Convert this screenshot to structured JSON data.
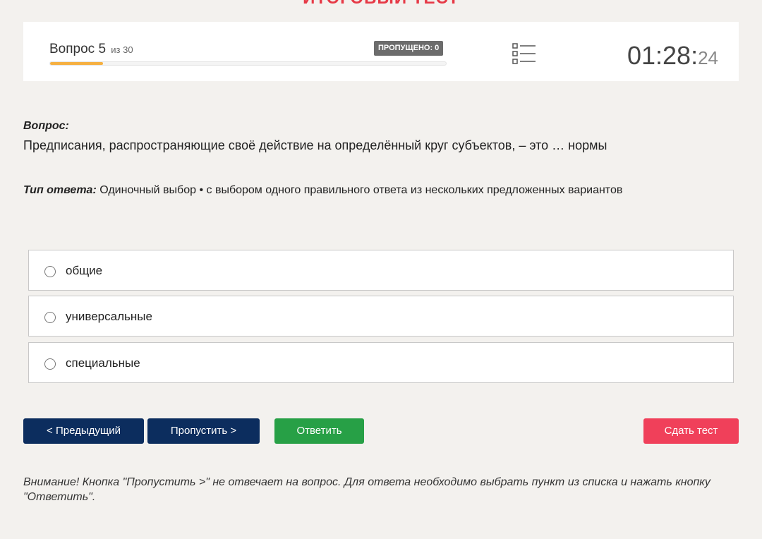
{
  "page": {
    "title": "ИТОГОВЫЙ ТЕСТ"
  },
  "header": {
    "question_prefix": "Вопрос 5",
    "question_of": "из 30",
    "skipped_badge": "ПРОПУЩЕНО: 0",
    "progress_fraction": 0.133,
    "list_icon": "list-icon",
    "timer_main": "01:28:",
    "timer_seconds": "24"
  },
  "question": {
    "label": "Вопрос:",
    "text": "Предписания, распространяющие своё действие на определённый круг субъектов, – это … нормы",
    "answer_type_label": "Тип ответа:",
    "answer_type_value": "Одиночный выбор • с выбором одного правильного ответа из нескольких предложенных вариантов"
  },
  "options": [
    {
      "label": "общие",
      "selected": false
    },
    {
      "label": "универсальные",
      "selected": false
    },
    {
      "label": "специальные",
      "selected": false
    }
  ],
  "buttons": {
    "prev": "< Предыдущий",
    "skip": "Пропустить >",
    "answer": "Ответить",
    "submit": "Сдать тест"
  },
  "notice": "Внимание! Кнопка \"Пропустить >\" не отвечает на вопрос. Для ответа необходимо выбрать пункт из списка и нажать кнопку \"Ответить\".",
  "colors": {
    "title": "#e63946",
    "progress": "#f5b041",
    "nav_button": "#0c2d5e",
    "answer_button": "#27a046",
    "submit_button": "#f0405a"
  }
}
